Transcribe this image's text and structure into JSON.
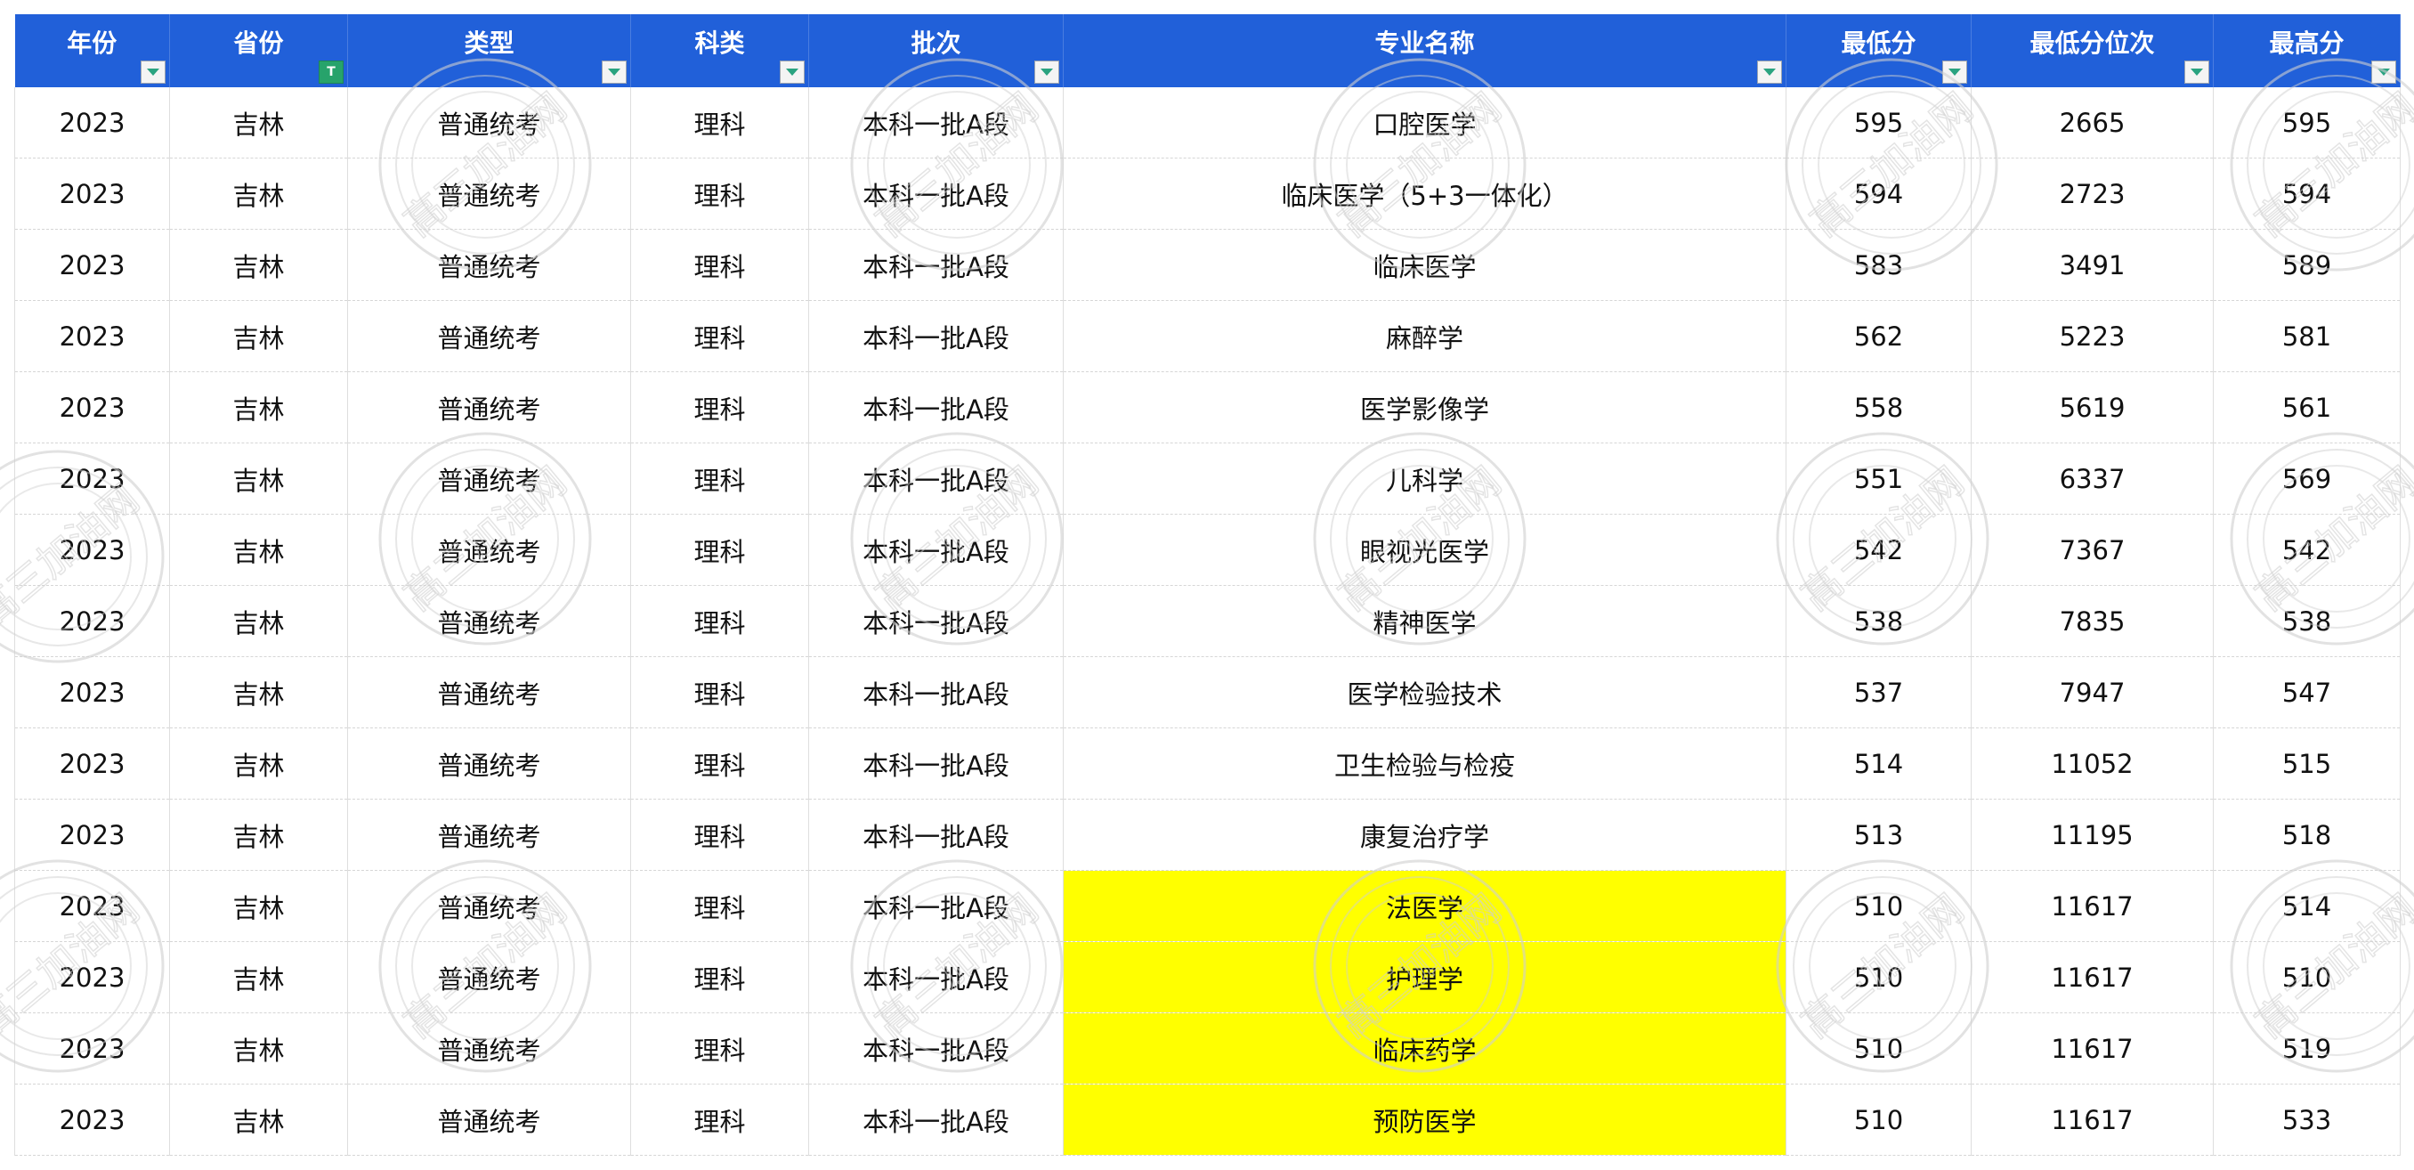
{
  "table": {
    "headers": [
      {
        "key": "year",
        "label": "年份",
        "filter": "normal"
      },
      {
        "key": "province",
        "label": "省份",
        "filter": "active"
      },
      {
        "key": "type",
        "label": "类型",
        "filter": "normal"
      },
      {
        "key": "track",
        "label": "科类",
        "filter": "normal"
      },
      {
        "key": "batch",
        "label": "批次",
        "filter": "normal"
      },
      {
        "key": "major",
        "label": "专业名称",
        "filter": "normal"
      },
      {
        "key": "min_score",
        "label": "最低分",
        "filter": "normal"
      },
      {
        "key": "min_rank",
        "label": "最低分位次",
        "filter": "normal"
      },
      {
        "key": "max_score",
        "label": "最高分",
        "filter": "normal"
      }
    ],
    "active_filter_glyph": "T",
    "rows": [
      {
        "year": "2023",
        "province": "吉林",
        "type": "普通统考",
        "track": "理科",
        "batch": "本科一批A段",
        "major": "口腔医学",
        "min_score": "595",
        "min_rank": "2665",
        "max_score": "595",
        "highlight": false
      },
      {
        "year": "2023",
        "province": "吉林",
        "type": "普通统考",
        "track": "理科",
        "batch": "本科一批A段",
        "major": "临床医学（5+3一体化）",
        "min_score": "594",
        "min_rank": "2723",
        "max_score": "594",
        "highlight": false
      },
      {
        "year": "2023",
        "province": "吉林",
        "type": "普通统考",
        "track": "理科",
        "batch": "本科一批A段",
        "major": "临床医学",
        "min_score": "583",
        "min_rank": "3491",
        "max_score": "589",
        "highlight": false
      },
      {
        "year": "2023",
        "province": "吉林",
        "type": "普通统考",
        "track": "理科",
        "batch": "本科一批A段",
        "major": "麻醉学",
        "min_score": "562",
        "min_rank": "5223",
        "max_score": "581",
        "highlight": false
      },
      {
        "year": "2023",
        "province": "吉林",
        "type": "普通统考",
        "track": "理科",
        "batch": "本科一批A段",
        "major": "医学影像学",
        "min_score": "558",
        "min_rank": "5619",
        "max_score": "561",
        "highlight": false
      },
      {
        "year": "2023",
        "province": "吉林",
        "type": "普通统考",
        "track": "理科",
        "batch": "本科一批A段",
        "major": "儿科学",
        "min_score": "551",
        "min_rank": "6337",
        "max_score": "569",
        "highlight": false
      },
      {
        "year": "2023",
        "province": "吉林",
        "type": "普通统考",
        "track": "理科",
        "batch": "本科一批A段",
        "major": "眼视光医学",
        "min_score": "542",
        "min_rank": "7367",
        "max_score": "542",
        "highlight": false
      },
      {
        "year": "2023",
        "province": "吉林",
        "type": "普通统考",
        "track": "理科",
        "batch": "本科一批A段",
        "major": "精神医学",
        "min_score": "538",
        "min_rank": "7835",
        "max_score": "538",
        "highlight": false
      },
      {
        "year": "2023",
        "province": "吉林",
        "type": "普通统考",
        "track": "理科",
        "batch": "本科一批A段",
        "major": "医学检验技术",
        "min_score": "537",
        "min_rank": "7947",
        "max_score": "547",
        "highlight": false
      },
      {
        "year": "2023",
        "province": "吉林",
        "type": "普通统考",
        "track": "理科",
        "batch": "本科一批A段",
        "major": "卫生检验与检疫",
        "min_score": "514",
        "min_rank": "11052",
        "max_score": "515",
        "highlight": false
      },
      {
        "year": "2023",
        "province": "吉林",
        "type": "普通统考",
        "track": "理科",
        "batch": "本科一批A段",
        "major": "康复治疗学",
        "min_score": "513",
        "min_rank": "11195",
        "max_score": "518",
        "highlight": false
      },
      {
        "year": "2023",
        "province": "吉林",
        "type": "普通统考",
        "track": "理科",
        "batch": "本科一批A段",
        "major": "法医学",
        "min_score": "510",
        "min_rank": "11617",
        "max_score": "514",
        "highlight": true
      },
      {
        "year": "2023",
        "province": "吉林",
        "type": "普通统考",
        "track": "理科",
        "batch": "本科一批A段",
        "major": "护理学",
        "min_score": "510",
        "min_rank": "11617",
        "max_score": "510",
        "highlight": true
      },
      {
        "year": "2023",
        "province": "吉林",
        "type": "普通统考",
        "track": "理科",
        "batch": "本科一批A段",
        "major": "临床药学",
        "min_score": "510",
        "min_rank": "11617",
        "max_score": "519",
        "highlight": true
      },
      {
        "year": "2023",
        "province": "吉林",
        "type": "普通统考",
        "track": "理科",
        "batch": "本科一批A段",
        "major": "预防医学",
        "min_score": "510",
        "min_rank": "11617",
        "max_score": "533",
        "highlight": true
      }
    ]
  },
  "colors": {
    "header_bg": "#2160d9",
    "header_text": "#ffffff",
    "highlight": "#ffff00",
    "filter_active": "#27a36b",
    "filter_arrow": "#2aa380",
    "watermark": "#cfcfcf"
  },
  "watermark": {
    "text": "高三加油网"
  }
}
